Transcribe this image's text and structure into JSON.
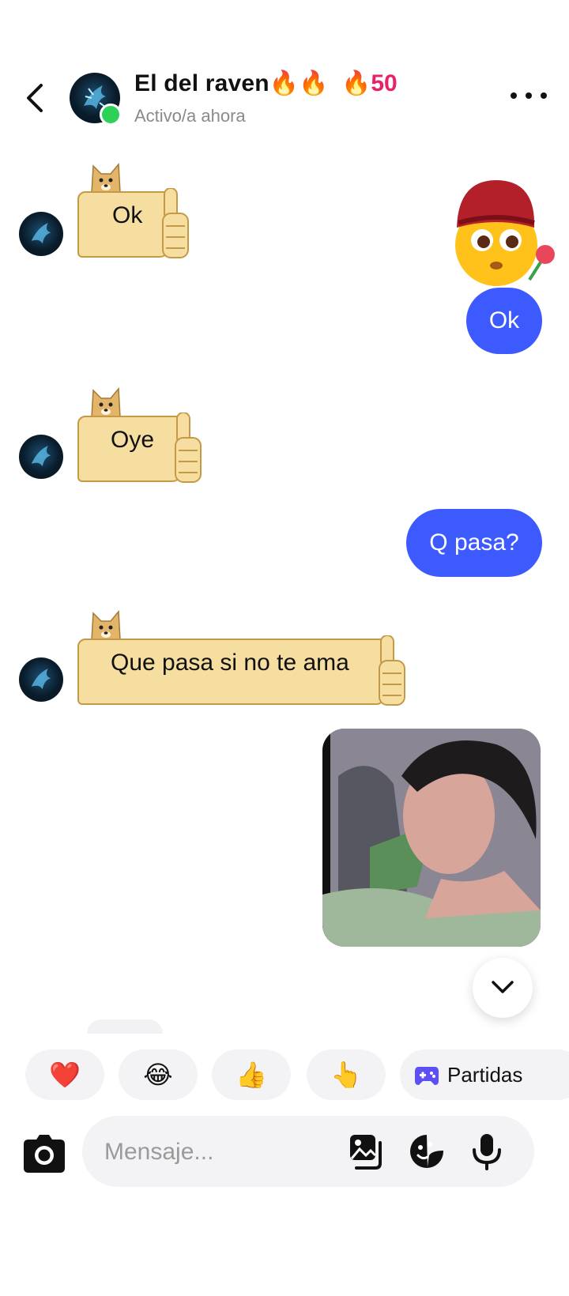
{
  "header": {
    "name": "El del raven🔥🔥",
    "streak": "🔥50",
    "status": "Activo/a ahora"
  },
  "messages": {
    "in_1": "Ok",
    "out_1": "Ok",
    "in_2": "Oye",
    "out_2": "Q pasa?",
    "in_3": "Que pasa si no te ama"
  },
  "quick_reactions": {
    "heart": "❤️",
    "laugh": "😂",
    "thumbs": "👍",
    "point": "👆",
    "games_label": "Partidas"
  },
  "composer": {
    "placeholder": "Mensaje..."
  },
  "colors": {
    "accent": "#3d5afe",
    "streak": "#e8226a",
    "online": "#2ed158",
    "sign": "#f5dea0"
  },
  "icons": [
    "back-arrow-icon",
    "more-dots-icon",
    "chevron-down-icon",
    "camera-icon",
    "gallery-icon",
    "sticker-icon",
    "microphone-icon",
    "gamepad-icon"
  ]
}
